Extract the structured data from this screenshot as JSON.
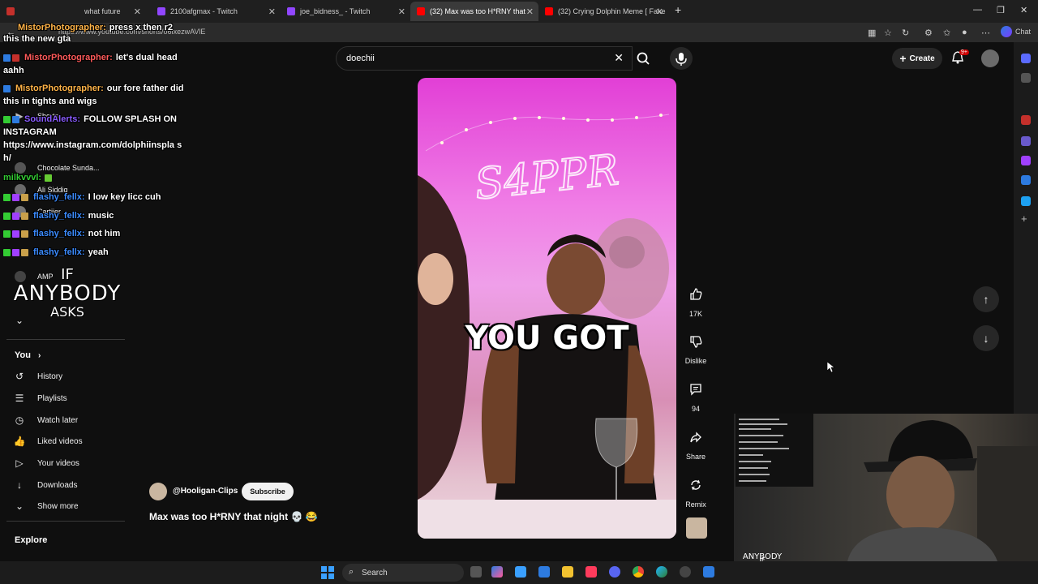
{
  "browser": {
    "tabs": [
      {
        "label": "what future",
        "color": "#c4302b"
      },
      {
        "label": "2100afgmax - Twitch",
        "color": "#9146ff"
      },
      {
        "label": "joe_bidness_ - Twitch",
        "color": "#9146ff"
      },
      {
        "label": "(32) Max was too H*RNY that",
        "color": "#ff0000"
      },
      {
        "label": "(32) Crying Dolphin Meme [ Fake",
        "color": "#ff0000"
      }
    ],
    "new_tab": "+",
    "url": "https://www.youtube.com/shorts/o6lxezwAVlE",
    "chat_label": "Chat"
  },
  "header": {
    "search_value": "doechii",
    "create_label": "Create",
    "notif_count": "9+"
  },
  "chat_overlay": [
    {
      "name": "",
      "text": "this the new gta",
      "color": "#ffffff"
    },
    {
      "name": "MistorPhotographer:",
      "text": "press x then r2",
      "color": "#ffb347"
    },
    {
      "name": "MistorPhotographer:",
      "text": "let's dual head",
      "color": "#ff5a5a"
    },
    {
      "name": "",
      "text": "aahh",
      "color": "#ffffff"
    },
    {
      "name": "MistorPhotographer:",
      "text": "our fore father did",
      "color": "#ffb347"
    },
    {
      "name": "",
      "text": "this in tights and wigs",
      "color": "#ffffff"
    },
    {
      "name": "SoundAlerts:",
      "text": "FOLLOW SPLASH ON",
      "color": "#8a5cff"
    },
    {
      "name": "",
      "text": "INSTAGRAM",
      "color": "#ffffff"
    },
    {
      "name": "",
      "text": "https://www.instagram.com/dolphiinspla s",
      "color": "#ffffff"
    },
    {
      "name": "",
      "text": "h/",
      "color": "#ffffff"
    },
    {
      "name": "milkvvvl:",
      "text": "",
      "color": "#33cc33"
    },
    {
      "name": "flashy_fellx:",
      "text": "I low key licc cuh",
      "color": "#3b8bff"
    },
    {
      "name": "flashy_fellx:",
      "text": "music",
      "color": "#3b8bff"
    },
    {
      "name": "flashy_fellx:",
      "text": "not him",
      "color": "#3b8bff"
    },
    {
      "name": "flashy_fellx:",
      "text": "yeah",
      "color": "#3b8bff"
    }
  ],
  "sidebar": {
    "shorts_label": "Shorts",
    "subscriptions": [
      {
        "label": "Chocolate Sunda..."
      },
      {
        "label": "Ali Siddiq"
      },
      {
        "label": "Cartiier"
      },
      {
        "label": "AMP"
      }
    ],
    "you_label": "You",
    "you_items": [
      {
        "label": "History",
        "icon": "history-icon"
      },
      {
        "label": "Playlists",
        "icon": "playlists-icon"
      },
      {
        "label": "Watch later",
        "icon": "watch-later-icon"
      },
      {
        "label": "Liked videos",
        "icon": "liked-videos-icon"
      },
      {
        "label": "Your videos",
        "icon": "your-videos-icon"
      },
      {
        "label": "Downloads",
        "icon": "downloads-icon"
      },
      {
        "label": "Show more",
        "icon": "chevron-down-icon"
      }
    ],
    "explore_label": "Explore"
  },
  "overlay_text": {
    "line1": "IF",
    "line2": "ANYBODY",
    "line3": "ASKS"
  },
  "video": {
    "caption": "YOU GOT",
    "neon_text": "S4PPR"
  },
  "actions": {
    "likes": "17K",
    "dislike": "Dislike",
    "comments": "94",
    "share": "Share",
    "remix": "Remix"
  },
  "channel": {
    "handle": "@Hooligan-Clips",
    "subscribe": "Subscribe",
    "title": "Max was too H*RNY that night 💀 😂"
  },
  "taskbar": {
    "search": "Search"
  }
}
